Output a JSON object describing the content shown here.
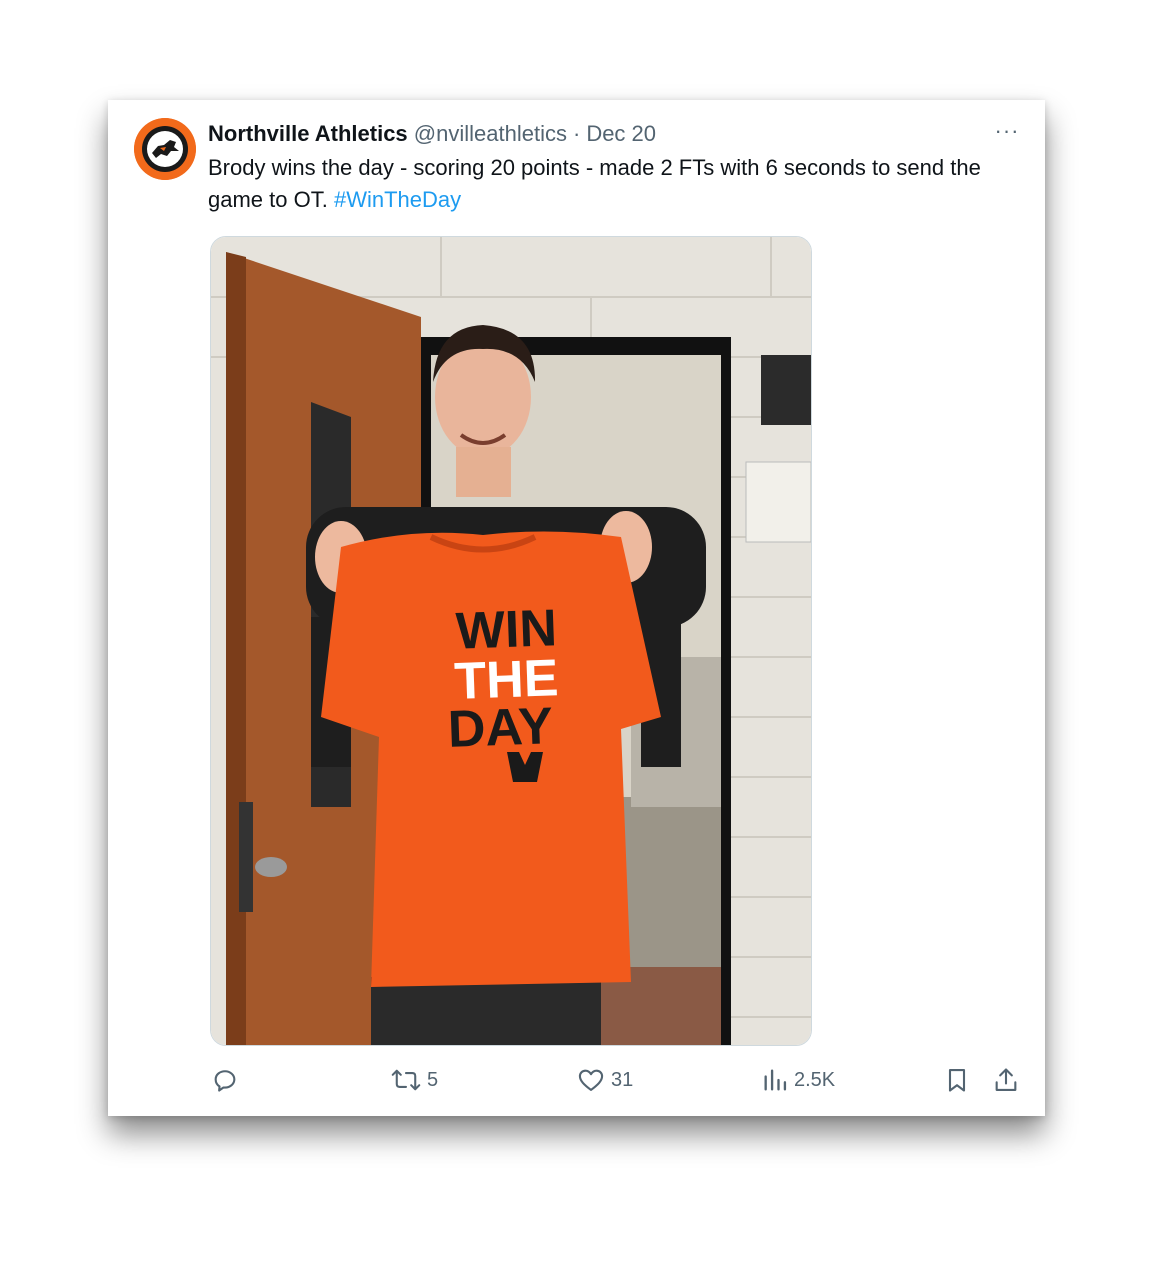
{
  "tweet": {
    "author_name": "Northville Athletics",
    "handle": "@nvilleathletics",
    "separator": "·",
    "date": "Dec 20",
    "more_label": "···",
    "text_main": "Brody wins the day - scoring 20 points - made 2 FTs with 6 seconds to send the game to OT.",
    "hashtag": "#WinTheDay",
    "avatar_icon": "northville-mustangs-logo",
    "media": {
      "description_icon": "photo-student-holding-orange-shirt",
      "shirt_text": [
        "WIN",
        "THE",
        "DAY"
      ],
      "shirt_color": "#f25a1c"
    }
  },
  "actions": {
    "reply": {
      "icon": "reply-icon",
      "count": ""
    },
    "retweet": {
      "icon": "retweet-icon",
      "count": "5"
    },
    "like": {
      "icon": "heart-icon",
      "count": "31"
    },
    "views": {
      "icon": "views-icon",
      "count": "2.5K"
    },
    "bookmark": {
      "icon": "bookmark-icon"
    },
    "share": {
      "icon": "share-icon"
    }
  },
  "colors": {
    "text_primary": "#0f1419",
    "text_secondary": "#536471",
    "link": "#1d9bf0",
    "brand_orange": "#f26a1b"
  }
}
